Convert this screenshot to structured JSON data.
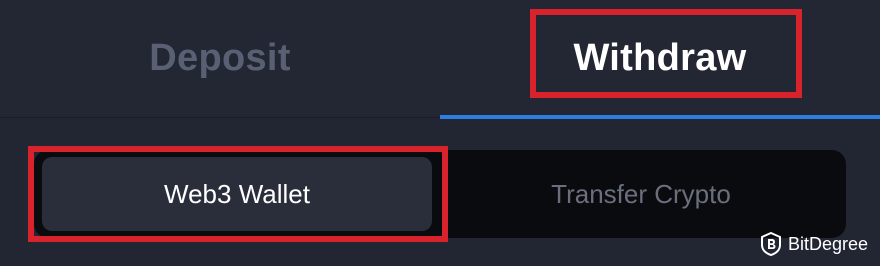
{
  "tabs": {
    "deposit_label": "Deposit",
    "withdraw_label": "Withdraw",
    "active": "Withdraw"
  },
  "wallet_type": {
    "options": [
      "Web3 Wallet",
      "Transfer Crypto"
    ],
    "selected": "Web3 Wallet"
  },
  "watermark": {
    "brand": "BitDegree"
  },
  "colors": {
    "background": "#222633",
    "accent_underline": "#2f7de1",
    "highlight_border": "#d9232c",
    "active_text": "#ffffff",
    "inactive_text": "#5a6074"
  }
}
